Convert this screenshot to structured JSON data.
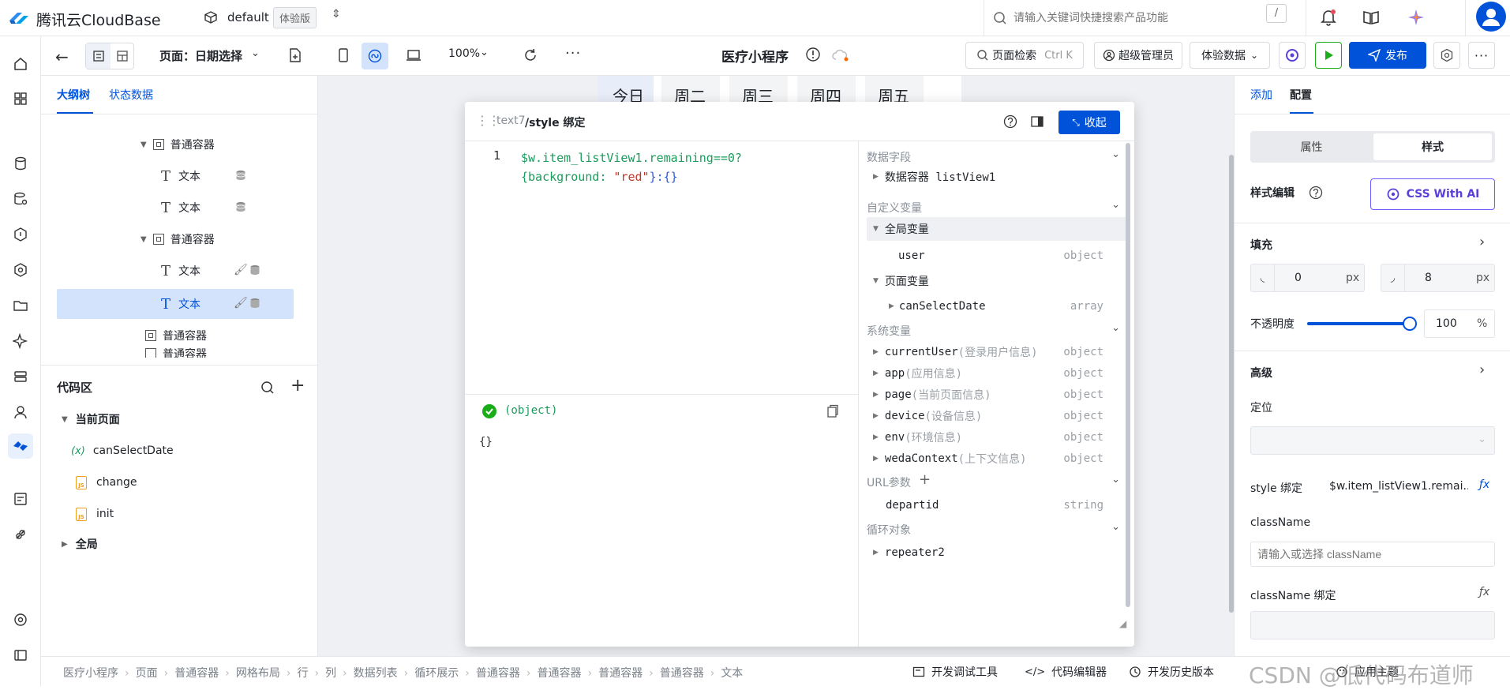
{
  "brand": {
    "name": "腾讯云CloudBase"
  },
  "env": {
    "name": "default",
    "badge": "体验版"
  },
  "search": {
    "placeholder": "请输入关键词快捷搜索产品功能",
    "shortcut": "/"
  },
  "toolbar": {
    "page_label": "页面：日期选择",
    "zoom": "100%",
    "app_title": "医疗小程序",
    "page_search": "页面检索",
    "page_search_shortcut": "Ctrl K",
    "admin": "超级管理员",
    "data_mode": "体验数据",
    "publish": "发布",
    "more": "···"
  },
  "left": {
    "tabs": [
      "大纲树",
      "状态数据"
    ],
    "tree": [
      {
        "label": "普通容器",
        "icon": "container"
      },
      {
        "label": "文本",
        "icon": "text"
      },
      {
        "label": "文本",
        "icon": "text"
      },
      {
        "label": "普通容器",
        "icon": "container"
      },
      {
        "label": "文本",
        "icon": "text"
      },
      {
        "label": "文本",
        "icon": "text"
      },
      {
        "label": "普通容器",
        "icon": "container"
      },
      {
        "label": "普通容器",
        "icon": "container"
      }
    ],
    "code_title": "代码区",
    "code": {
      "current_page": "当前页面",
      "items": [
        {
          "label": "canSelectDate",
          "icon": "(x)"
        },
        {
          "label": "change",
          "icon": "JS"
        },
        {
          "label": "init",
          "icon": "JS"
        }
      ],
      "global": "全局"
    }
  },
  "preview_tabs": [
    "今日",
    "周二",
    "周三",
    "周四",
    "周五"
  ],
  "binding": {
    "path_prefix": "text7",
    "path_title": "/style 绑定",
    "collapse": "收起",
    "line_no": "1",
    "code_line1": "$w.item_listView1.remaining==0?",
    "code_line2_a": "{background: ",
    "code_line2_b": "\"red\"",
    "code_line2_c": "}:{}",
    "result_type": "(object)",
    "result_value": "{}",
    "vars": {
      "data_fields": "数据字段",
      "data_container": "数据容器 listView1",
      "custom_vars": "自定义变量",
      "global_vars": "全局变量",
      "user": "user",
      "user_type": "object",
      "page_vars": "页面变量",
      "can_select": "canSelectDate",
      "can_select_type": "array",
      "system_vars": "系统变量",
      "system": [
        {
          "name": "currentUser",
          "desc": "(登录用户信息)",
          "type": "object"
        },
        {
          "name": "app",
          "desc": "(应用信息)",
          "type": "object"
        },
        {
          "name": "page",
          "desc": "(当前页面信息)",
          "type": "object"
        },
        {
          "name": "device",
          "desc": "(设备信息)",
          "type": "object"
        },
        {
          "name": "env",
          "desc": "(环境信息)",
          "type": "object"
        },
        {
          "name": "wedaContext",
          "desc": "(上下文信息)",
          "type": "object"
        }
      ],
      "url_params": "URL参数",
      "departid": "departid",
      "departid_type": "string",
      "loop_obj": "循环对象",
      "repeater": "repeater2"
    }
  },
  "right": {
    "tabs": [
      "添加",
      "配置"
    ],
    "seg": [
      "属性",
      "样式"
    ],
    "style_edit": "样式编辑",
    "css_ai": "CSS With AI",
    "fill": "填充",
    "radius_left": "0",
    "radius_right": "8",
    "unit": "px",
    "opacity_label": "不透明度",
    "opacity_value": "100",
    "opacity_unit": "%",
    "opacity": 1.0,
    "advanced": "高级",
    "position": "定位",
    "style_bind_label": "style 绑定",
    "style_bind_value": "$w.item_listView1.remai...",
    "classname": "className",
    "classname_placeholder": "请输入或选择 className",
    "classname_bind": "className 绑定"
  },
  "status": {
    "crumbs": [
      "医疗小程序",
      "页面",
      "普通容器",
      "网格布局",
      "行",
      "列",
      "数据列表",
      "循环展示",
      "普通容器",
      "普通容器",
      "普通容器",
      "普通容器",
      "文本"
    ],
    "dev_tools": "开发调试工具",
    "code_editor": "代码编辑器",
    "history": "开发历史版本",
    "theme": "应用主题",
    "watermark": "CSDN @低代码布道师"
  },
  "colors": {
    "accent": "#0052d9",
    "green": "#1aad19",
    "code_green": "#1a9c5b",
    "string_red": "#c0392b",
    "selected_bg": "#d4e3fc"
  }
}
